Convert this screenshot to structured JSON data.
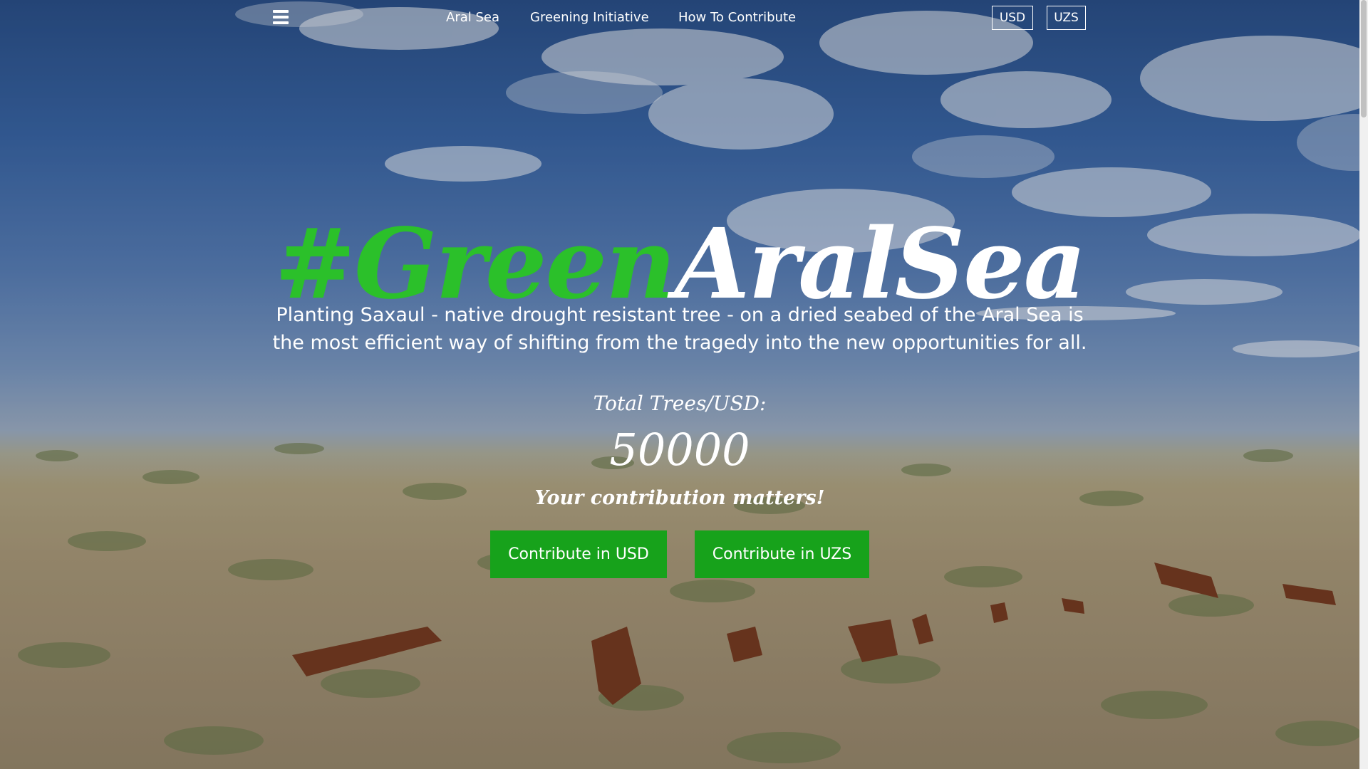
{
  "nav": {
    "menu_icon": "hamburger-menu-icon",
    "links": [
      "Aral Sea",
      "Greening Initiative",
      "How To Contribute"
    ],
    "currency": [
      "USD",
      "UZS"
    ]
  },
  "hero": {
    "title_green": "#Green",
    "title_white": "AralSea",
    "tagline": "Planting Saxaul - native drought resistant tree - on a dried seabed of the Aral Sea is the most efficient way of shifting from the tragedy into the new opportunities for all.",
    "stat_label": "Total Trees/USD:",
    "stat_value": "50000",
    "stat_sub": "Your contribution matters!",
    "cta_usd": "Contribute in USD",
    "cta_uzs": "Contribute in UZS"
  },
  "colors": {
    "accent_green": "#2bc02a",
    "button_green": "#17a21b"
  }
}
